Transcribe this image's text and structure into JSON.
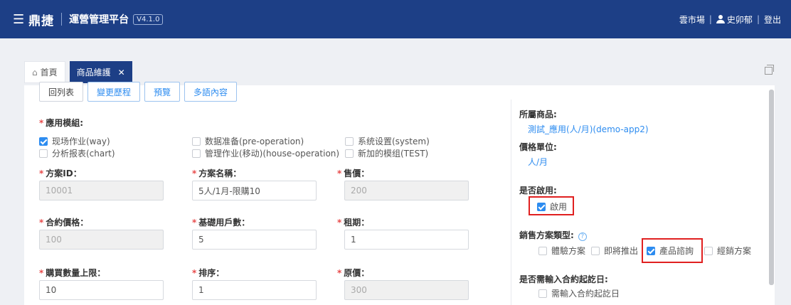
{
  "header": {
    "brand": "鼎捷",
    "platform": "運營管理平台",
    "version": "V4.1.0",
    "marketplace": "雲市場",
    "user": "史卯郁",
    "logout": "登出",
    "sep": "|"
  },
  "tabs": {
    "home": "首頁",
    "active": "商品維護",
    "close": "✕"
  },
  "toolbar": {
    "back": "回列表",
    "history": "變更歷程",
    "preview": "預覽",
    "multilang": "多語內容"
  },
  "form": {
    "req": "*",
    "modules_label": "應用模組:",
    "modules": [
      {
        "label": "现场作业(way)",
        "checked": true
      },
      {
        "label": "数据准备(pre-operation)",
        "checked": false
      },
      {
        "label": "系统设置(system)",
        "checked": false
      },
      {
        "label": "分析报表(chart)",
        "checked": false
      },
      {
        "label": "管理作业(移动)(house-operation)",
        "checked": false
      },
      {
        "label": "新加的模组(TEST)",
        "checked": false
      }
    ],
    "plan_id_label": "方案ID：",
    "plan_id": "10001",
    "plan_name_label": "方案名稱：",
    "plan_name": "5人/1月-限購10",
    "price_label": "售價：",
    "price": "200",
    "contract_price_label": "合約價格：",
    "contract_price": "100",
    "base_users_label": "基礎用戶數：",
    "base_users": "5",
    "rent_period_label": "租期：",
    "rent_period": "1",
    "max_qty_label": "購買數量上限：",
    "max_qty": "10",
    "sort_label": "排序：",
    "sort": "1",
    "orig_price_label": "原價：",
    "orig_price": "300"
  },
  "side": {
    "product_label": "所屬商品:",
    "product": "測試_應用(人/月)(demo-app2)",
    "unit_label": "價格單位:",
    "unit": "人/月",
    "enabled_label": "是否啟用:",
    "enabled": "啟用",
    "sales_type_label": "銷售方案類型:",
    "help": "?",
    "sales_types": [
      {
        "label": "體驗方案",
        "checked": false
      },
      {
        "label": "即將推出",
        "checked": false
      },
      {
        "label": "產品諮詢",
        "checked": true
      },
      {
        "label": "經銷方案",
        "checked": false
      }
    ],
    "contract_date_label": "是否需輸入合約起訖日:",
    "contract_date": "需輸入合約起訖日"
  },
  "colors": {
    "header_bg": "#1d3f86",
    "accent": "#2d8cf0",
    "required": "#e84a4a",
    "highlight": "#e02020"
  }
}
